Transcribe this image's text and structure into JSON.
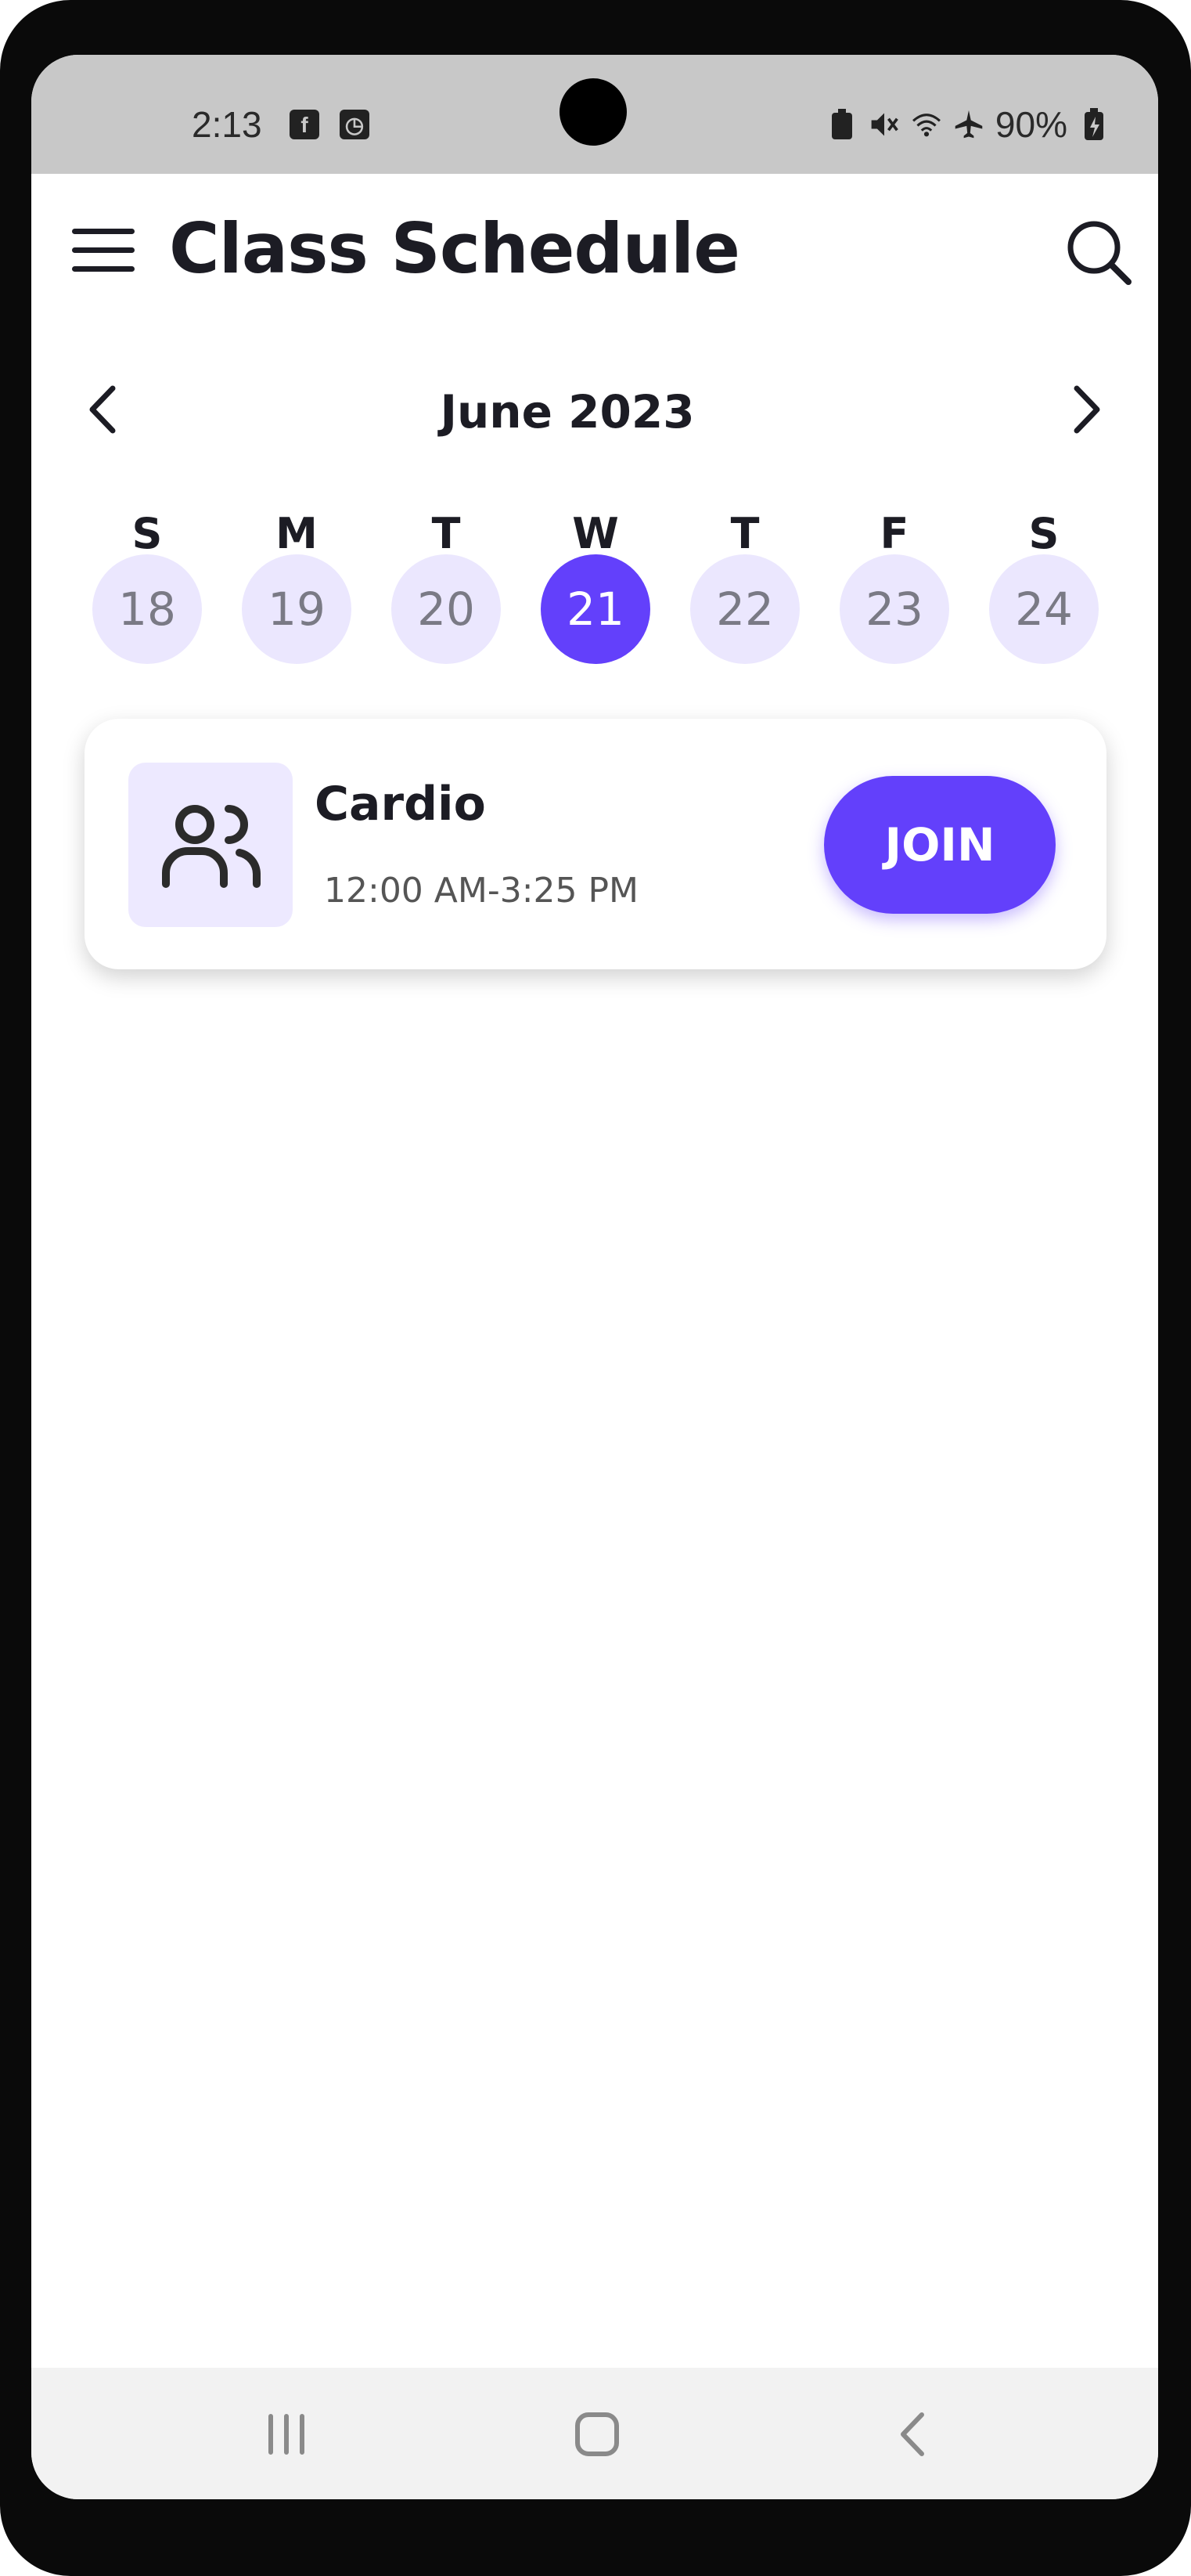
{
  "status_bar": {
    "time": "2:13",
    "notif_icons": [
      "facebook-icon",
      "clock-app-icon"
    ],
    "battery": "90%"
  },
  "header": {
    "title": "Class Schedule"
  },
  "calendar": {
    "month": "June 2023",
    "weekdays": [
      "S",
      "M",
      "T",
      "W",
      "T",
      "F",
      "S"
    ],
    "days": [
      "18",
      "19",
      "20",
      "21",
      "22",
      "23",
      "24"
    ],
    "selected_day": "21"
  },
  "classes": [
    {
      "name": "Cardio",
      "time": "12:00 AM-3:25 PM",
      "action": "JOIN"
    }
  ],
  "colors": {
    "accent": "#6340fb",
    "day_bg": "#ebe7fe",
    "text": "#1c1c24"
  }
}
